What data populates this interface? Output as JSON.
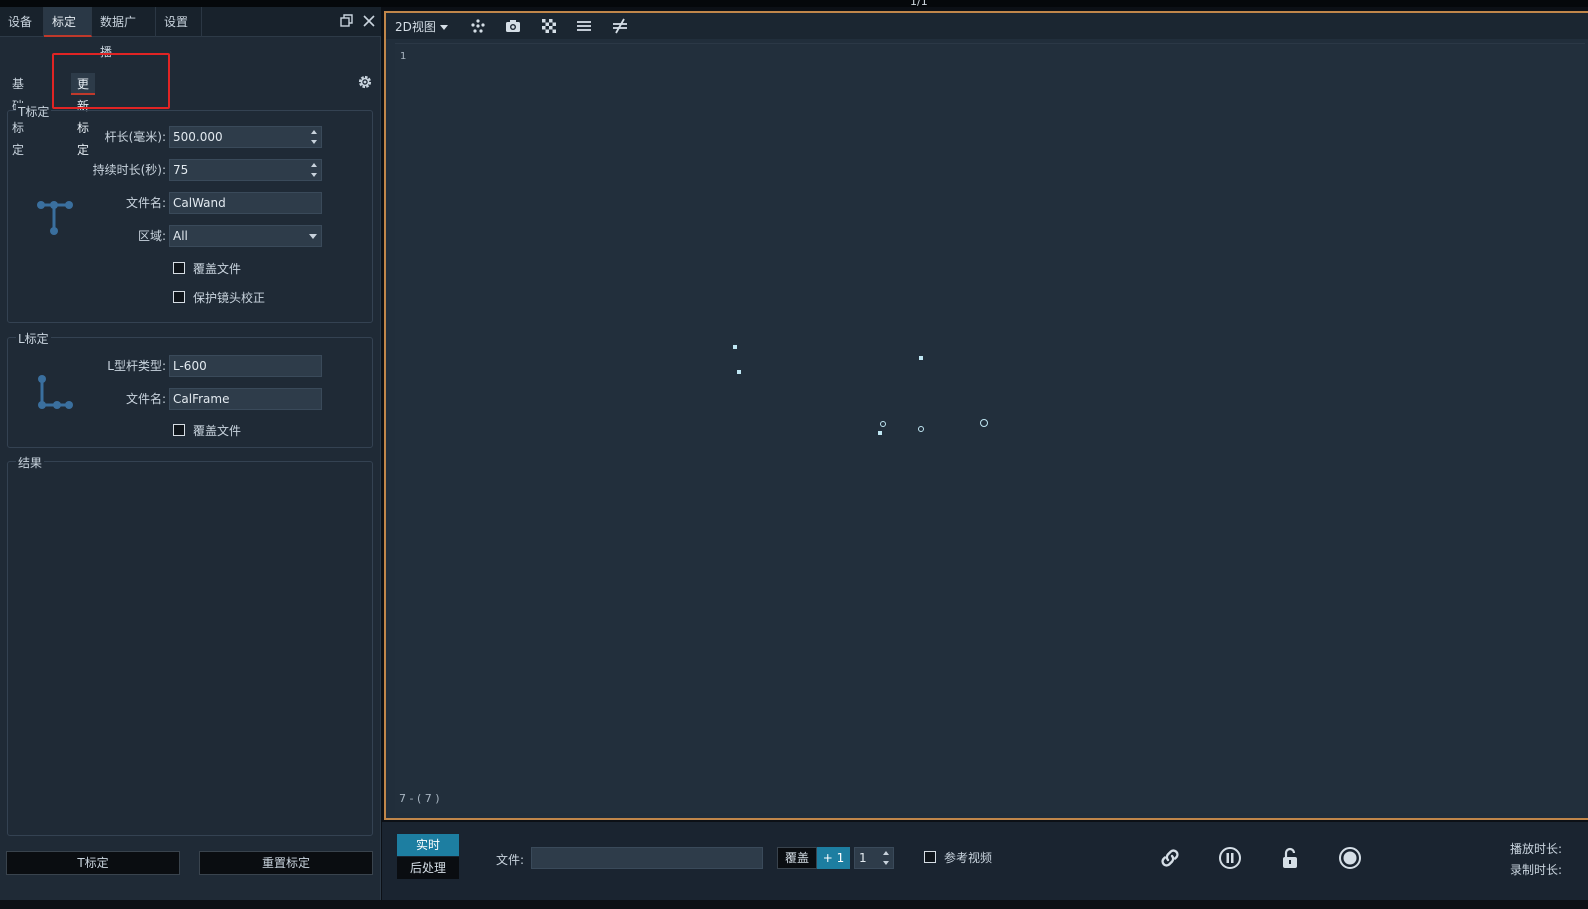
{
  "top_strip": {
    "pager": "1/1"
  },
  "nav": {
    "tabs": [
      {
        "label": "设备"
      },
      {
        "label": "标定"
      },
      {
        "label": "数据广播"
      },
      {
        "label": "设置"
      }
    ],
    "active_tab": "标定"
  },
  "calibration": {
    "subtabs": [
      {
        "label": "基础标定"
      },
      {
        "label": "更新标定"
      }
    ],
    "active_subtab": "更新标定",
    "t_group": {
      "title": "T标定",
      "wand_length_label": "杆长(毫米):",
      "wand_length_value": "500.000",
      "duration_label": "持续时长(秒):",
      "duration_value": "75",
      "filename_label": "文件名:",
      "filename_value": "CalWand",
      "region_label": "区域:",
      "region_value": "All",
      "overwrite_label": "覆盖文件",
      "protect_lens_label": "保护镜头校正"
    },
    "l_group": {
      "title": "L标定",
      "type_label": "L型杆类型:",
      "type_value": "L-600",
      "filename_label": "文件名:",
      "filename_value": "CalFrame",
      "overwrite_label": "覆盖文件"
    },
    "result_group": {
      "title": "结果"
    },
    "buttons": {
      "t_calibrate": "T标定",
      "reset_calibrate": "重置标定"
    }
  },
  "view": {
    "mode_label": "2D视图",
    "camera_number": "1",
    "marker_count": "7 - ( 7 )",
    "toolbar_icons": [
      "markers-icon",
      "camera-icon",
      "checkerboard-icon",
      "lines-icon",
      "not-equal-icon"
    ]
  },
  "playback": {
    "live_label": "实时",
    "post_label": "后处理",
    "file_label": "文件:",
    "file_value": "",
    "overlay_label": "覆盖",
    "plus_label": "+ 1",
    "step_value": "1",
    "reference_video_label": "参考视频",
    "play_duration_label": "播放时长:",
    "record_duration_label": "录制时长:"
  },
  "colors": {
    "accent_red": "#e02424",
    "accent_blue": "#1d7ea1",
    "view_border": "#c0864a",
    "panel_bg": "#1f2a36",
    "view_bg": "#222f3c"
  }
}
